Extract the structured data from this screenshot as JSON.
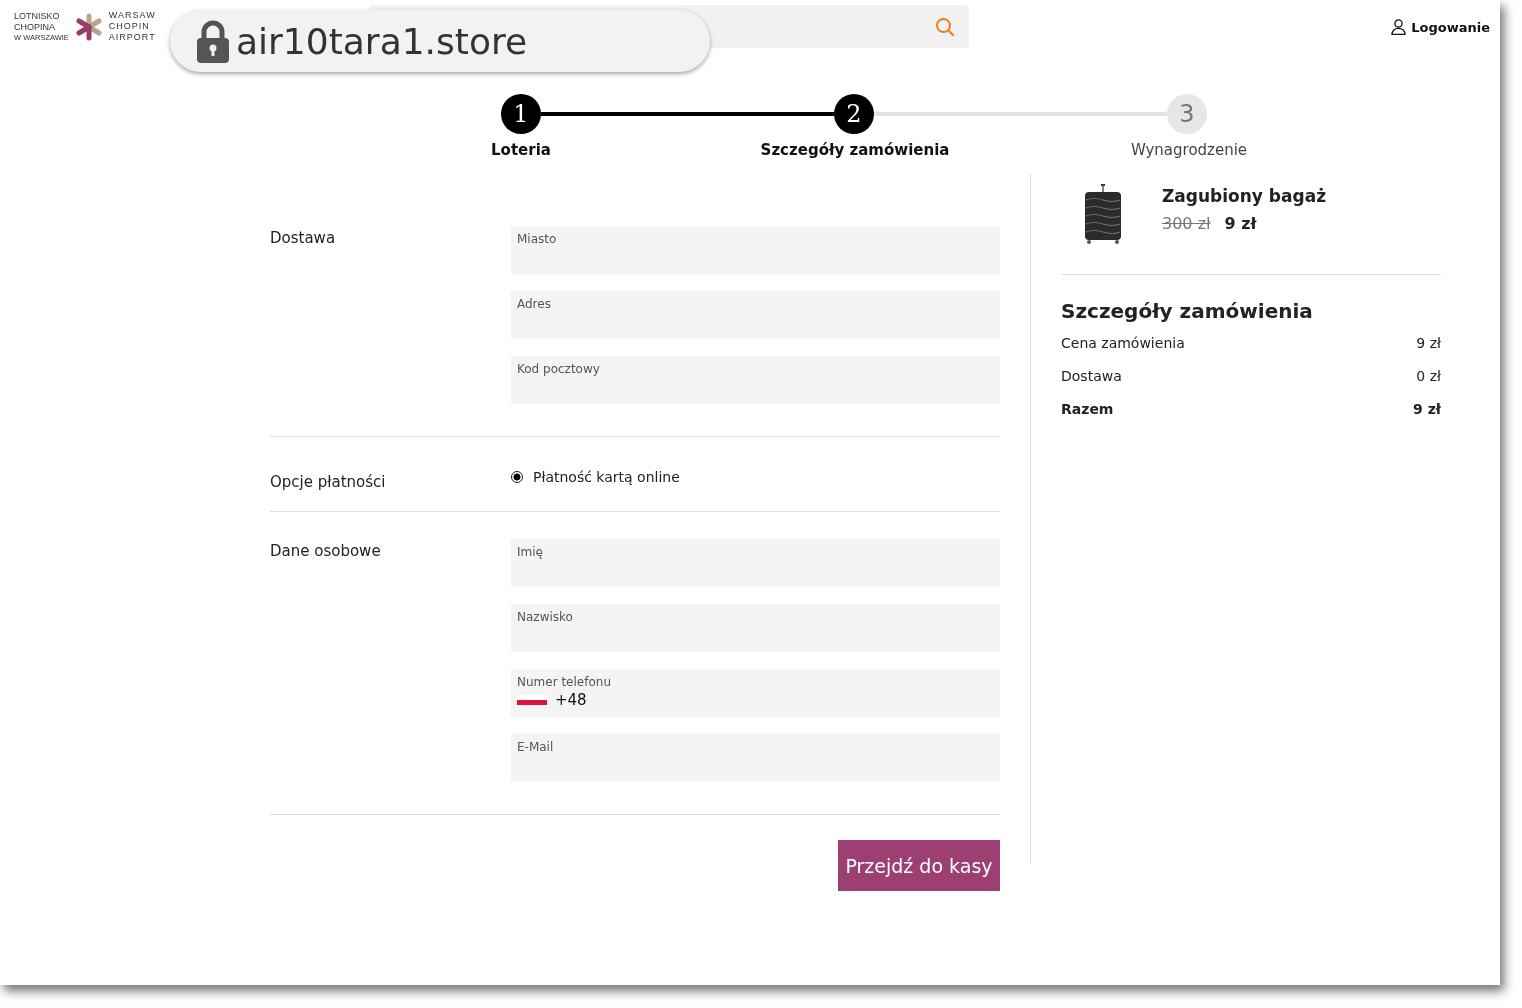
{
  "header": {
    "logo": {
      "left_lines": [
        "LOTNISKO",
        "CHOPINA",
        "W WARSZAWIE"
      ],
      "right_lines": [
        "WARSAW",
        "CHOPIN",
        "AIRPORT"
      ]
    },
    "login": "Logowanie"
  },
  "address_bar": {
    "url": "air10tara1.store"
  },
  "steps": [
    {
      "number": "1",
      "label": "Loteria",
      "reached": true
    },
    {
      "number": "2",
      "label": "Szczegóły zamówienia",
      "reached": true
    },
    {
      "number": "3",
      "label": "Wynagrodzenie",
      "reached": false
    }
  ],
  "form": {
    "sections": [
      {
        "title": "Dostawa",
        "kind": "fields",
        "fields": [
          {
            "label": "Miasto"
          },
          {
            "label": "Adres"
          },
          {
            "label": "Kod pocztowy"
          }
        ]
      },
      {
        "title": "Opcje płatności",
        "kind": "options",
        "options": [
          {
            "label": "Płatność kartą online",
            "selected": true
          }
        ]
      },
      {
        "title": "Dane osobowe",
        "kind": "fields",
        "fields": [
          {
            "label": "Imię"
          },
          {
            "label": "Nazwisko"
          },
          {
            "label": "Numer telefonu",
            "value": "+48",
            "kind": "phone"
          },
          {
            "label": "E-Mail"
          }
        ]
      }
    ],
    "submit": "Przejdź do kasy"
  },
  "summary": {
    "product": {
      "name": "Zagubiony bagaż",
      "old_price": "300 zł",
      "price": "9 zł"
    },
    "title": "Szczegóły zamówienia",
    "rows": [
      {
        "label": "Cena zamówienia",
        "value": "9 zł",
        "bold": false
      },
      {
        "label": "Dostawa",
        "value": "0 zł",
        "bold": false
      },
      {
        "label": "Razem",
        "value": "9 zł",
        "bold": true
      }
    ]
  }
}
